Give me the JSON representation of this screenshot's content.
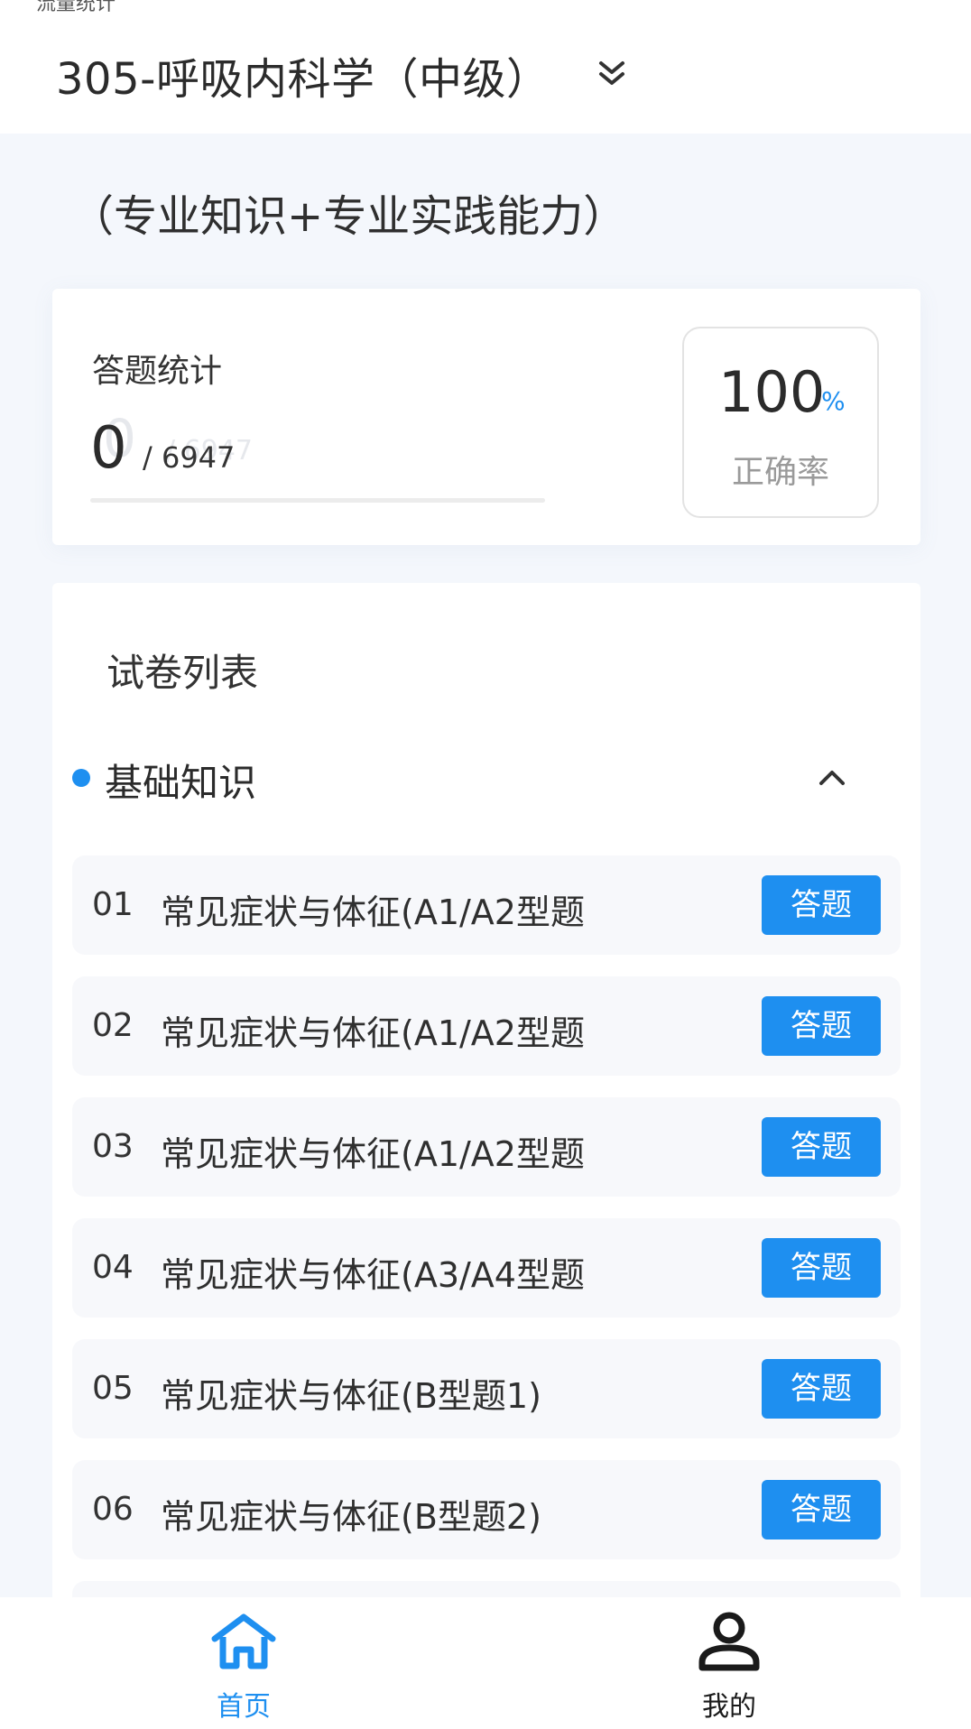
{
  "header": {
    "status_fragment": "流量统计",
    "subject_title": "305-呼吸内科学（中级）",
    "expand_icon": "double-chevron-down-icon"
  },
  "subtitle": "（专业知识+专业实践能力）",
  "stats": {
    "label": "答题统计",
    "ghost_count": "0",
    "ghost_total": "/ 6947",
    "answered": "0",
    "total": "/ 6947",
    "progress_fraction": 0,
    "accuracy_value": "100",
    "accuracy_unit": "%",
    "accuracy_label": "正确率"
  },
  "paper_list": {
    "title": "试卷列表",
    "section": {
      "title": "基础知识",
      "collapse_icon": "chevron-up-icon"
    },
    "items": [
      {
        "num": "01",
        "name": "常见症状与体征(A1/A2型题",
        "button": "答题"
      },
      {
        "num": "02",
        "name": "常见症状与体征(A1/A2型题",
        "button": "答题"
      },
      {
        "num": "03",
        "name": "常见症状与体征(A1/A2型题",
        "button": "答题"
      },
      {
        "num": "04",
        "name": "常见症状与体征(A3/A4型题",
        "button": "答题"
      },
      {
        "num": "05",
        "name": "常见症状与体征(B型题1)",
        "button": "答题"
      },
      {
        "num": "06",
        "name": "常见症状与体征(B型题2)",
        "button": "答题"
      }
    ]
  },
  "bottom_nav": {
    "home": {
      "label": "首页",
      "icon": "home-icon"
    },
    "mine": {
      "label": "我的",
      "icon": "user-icon"
    }
  },
  "colors": {
    "accent": "#1e8ff0",
    "background": "#f4f7fc",
    "nav_inactive": "#1a1a1a"
  }
}
